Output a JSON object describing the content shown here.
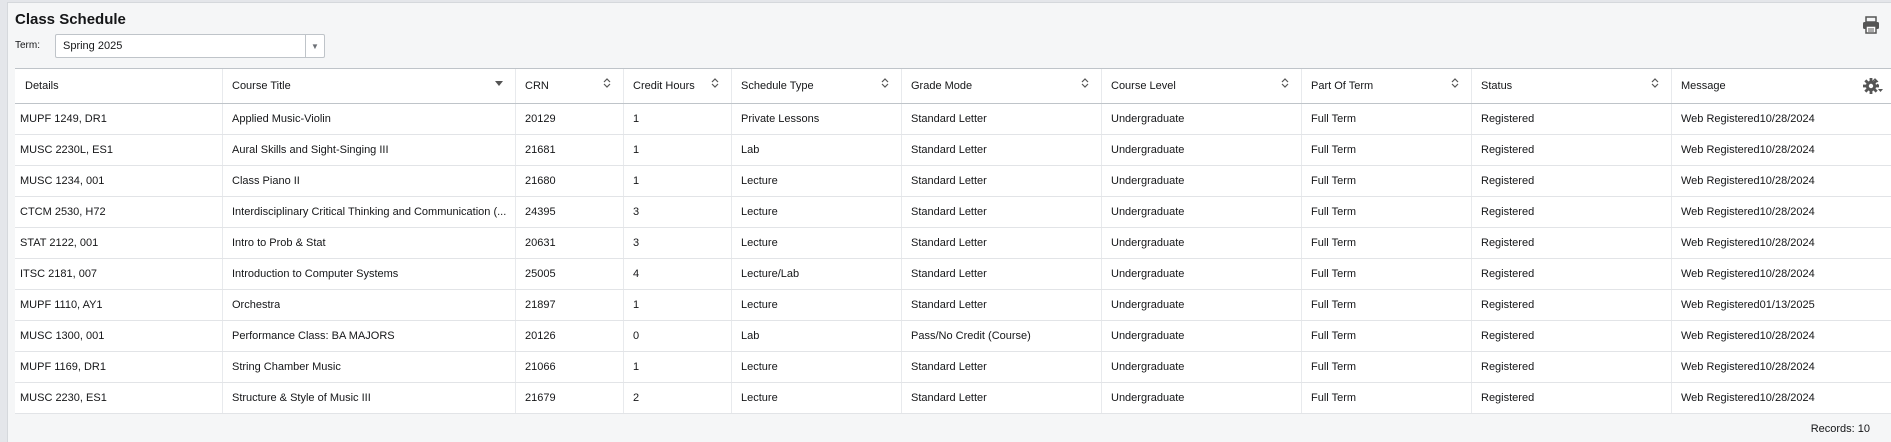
{
  "page": {
    "title": "Class Schedule",
    "term_label": "Term:",
    "term_value": "Spring 2025"
  },
  "table": {
    "columns": [
      "Details",
      "Course Title",
      "CRN",
      "Credit Hours",
      "Schedule Type",
      "Grade Mode",
      "Course Level",
      "Part Of Term",
      "Status",
      "Message"
    ],
    "rows": [
      [
        "MUPF 1249, DR1",
        "Applied Music-Violin",
        "20129",
        "1",
        "Private Lessons",
        "Standard Letter",
        "Undergraduate",
        "Full Term",
        "Registered",
        "Web Registered10/28/2024"
      ],
      [
        "MUSC 2230L, ES1",
        "Aural Skills and Sight-Singing III",
        "21681",
        "1",
        "Lab",
        "Standard Letter",
        "Undergraduate",
        "Full Term",
        "Registered",
        "Web Registered10/28/2024"
      ],
      [
        "MUSC 1234, 001",
        "Class Piano II",
        "21680",
        "1",
        "Lecture",
        "Standard Letter",
        "Undergraduate",
        "Full Term",
        "Registered",
        "Web Registered10/28/2024"
      ],
      [
        "CTCM 2530, H72",
        "Interdisciplinary Critical Thinking and Communication (...",
        "24395",
        "3",
        "Lecture",
        "Standard Letter",
        "Undergraduate",
        "Full Term",
        "Registered",
        "Web Registered10/28/2024"
      ],
      [
        "STAT 2122, 001",
        "Intro to Prob & Stat",
        "20631",
        "3",
        "Lecture",
        "Standard Letter",
        "Undergraduate",
        "Full Term",
        "Registered",
        "Web Registered10/28/2024"
      ],
      [
        "ITSC 2181, 007",
        "Introduction to Computer Systems",
        "25005",
        "4",
        "Lecture/Lab",
        "Standard Letter",
        "Undergraduate",
        "Full Term",
        "Registered",
        "Web Registered10/28/2024"
      ],
      [
        "MUPF 1110, AY1",
        "Orchestra",
        "21897",
        "1",
        "Lecture",
        "Standard Letter",
        "Undergraduate",
        "Full Term",
        "Registered",
        "Web Registered01/13/2025"
      ],
      [
        "MUSC 1300, 001",
        "Performance Class: BA MAJORS",
        "20126",
        "0",
        "Lab",
        "Pass/No Credit (Course)",
        "Undergraduate",
        "Full Term",
        "Registered",
        "Web Registered10/28/2024"
      ],
      [
        "MUPF 1169, DR1",
        "String Chamber Music",
        "21066",
        "1",
        "Lecture",
        "Standard Letter",
        "Undergraduate",
        "Full Term",
        "Registered",
        "Web Registered10/28/2024"
      ],
      [
        "MUSC 2230, ES1",
        "Structure & Style of Music III",
        "21679",
        "2",
        "Lecture",
        "Standard Letter",
        "Undergraduate",
        "Full Term",
        "Registered",
        "Web Registered10/28/2024"
      ]
    ]
  },
  "footer": {
    "records": "Records: 10"
  },
  "icons": {
    "print": "print-icon",
    "gear": "gear-icon",
    "sort": "sort-icon",
    "dropdown": "chevron-down-icon"
  }
}
